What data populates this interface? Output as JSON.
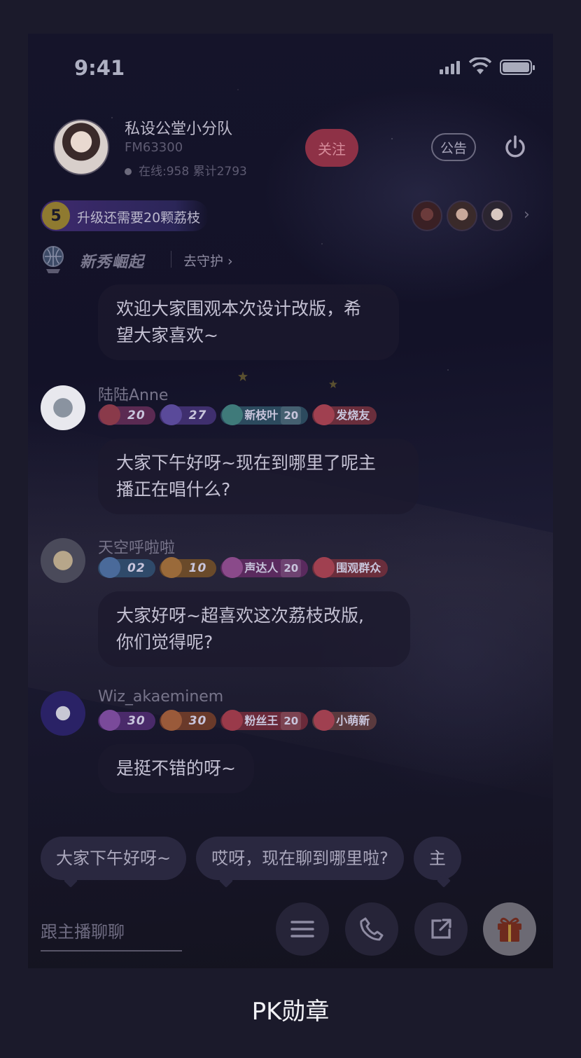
{
  "status": {
    "time": "9:41"
  },
  "host": {
    "name": "私设公堂小分队",
    "id": "FM63300",
    "stats": "在线:958  累计2793",
    "follow_label": "关注",
    "notice_label": "公告"
  },
  "level": {
    "number": "5",
    "text": "升级还需要20颗荔枝"
  },
  "guard": {
    "title": "新秀崛起",
    "link": "去守护 ›"
  },
  "messages": [
    {
      "text_line1": "欢迎大家围观本次设计改版，希",
      "text_line2": "望大家喜欢~"
    },
    {
      "user": "陆陆Anne",
      "badges": [
        {
          "label": "20",
          "color": "#5b2a52"
        },
        {
          "label": "27",
          "color": "#3f2f6e"
        },
        {
          "label": "新枝叶",
          "level": "20",
          "color": "#2c4a5e"
        },
        {
          "label": "发烧友",
          "color": "#6a2e3c"
        }
      ],
      "text_line1": "大家下午好呀~现在到哪里了呢主",
      "text_line2": "播正在唱什么?"
    },
    {
      "user": "天空呼啦啦",
      "badges": [
        {
          "label": "02",
          "color": "#2f4a6a"
        },
        {
          "label": "10",
          "color": "#6a4a2a"
        },
        {
          "label": "声达人",
          "level": "20",
          "color": "#5a2a5e"
        },
        {
          "label": "围观群众",
          "color": "#6a2e3c"
        }
      ],
      "text_line1": "大家好呀~超喜欢这次荔枝改版,",
      "text_line2": "你们觉得呢?"
    },
    {
      "user": "Wiz_akaeminem",
      "badges": [
        {
          "label": "30",
          "color": "#4a2a6a"
        },
        {
          "label": "30",
          "color": "#6a3a2a"
        },
        {
          "label": "粉丝王",
          "level": "20",
          "color": "#6a2a3a"
        },
        {
          "label": "小萌新",
          "color": "#5a3a3e"
        }
      ],
      "text_line1": "是挺不错的呀~"
    }
  ],
  "quick_replies": [
    "大家下午好呀~",
    "哎呀，现在聊到哪里啦?",
    "主"
  ],
  "input": {
    "placeholder": "跟主播聊聊"
  },
  "caption": "PK勋章"
}
